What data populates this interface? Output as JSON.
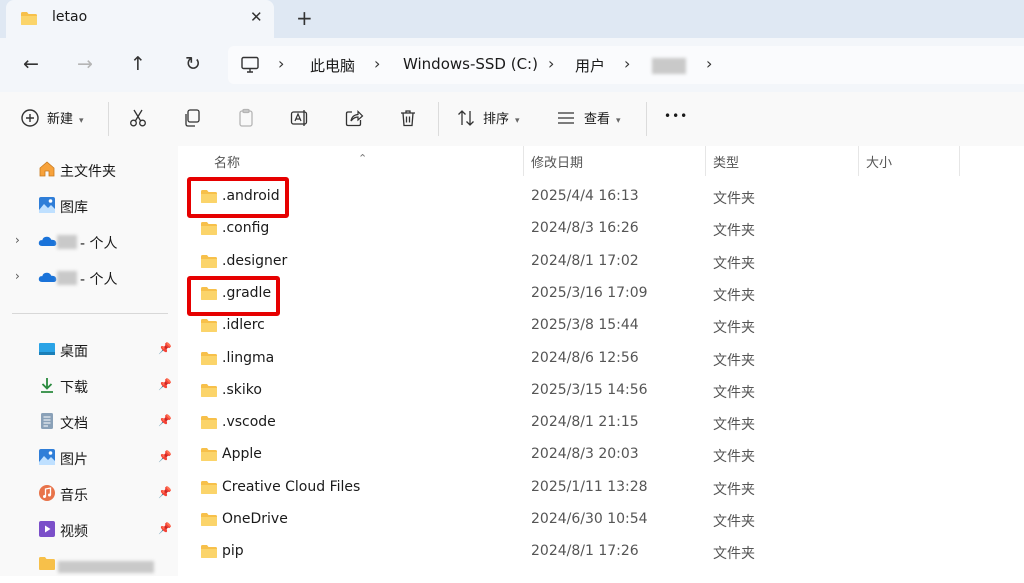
{
  "tab": {
    "title": "letao",
    "close_glyph": "✕",
    "new_glyph": "+"
  },
  "nav": {
    "back": "←",
    "forward": "→",
    "up": "↑",
    "refresh": "↻"
  },
  "breadcrumb": {
    "items": [
      "此电脑",
      "Windows-SSD (C:)",
      "用户"
    ],
    "separator": "›"
  },
  "toolbar": {
    "new_label": "新建",
    "sort_label": "排序",
    "view_label": "查看",
    "more_glyph": "•••"
  },
  "sidebar": {
    "home": "主文件夹",
    "gallery": "图库",
    "onedrive1_suffix": "- 个人",
    "onedrive2_suffix": "- 个人",
    "pinned": [
      "桌面",
      "下载",
      "文档",
      "图片",
      "音乐",
      "视频"
    ]
  },
  "columns": {
    "name": "名称",
    "date": "修改日期",
    "type": "类型",
    "size": "大小"
  },
  "files": [
    {
      "name": ".android",
      "date": "2025/4/4 16:13",
      "type": "文件夹"
    },
    {
      "name": ".config",
      "date": "2024/8/3 16:26",
      "type": "文件夹"
    },
    {
      "name": ".designer",
      "date": "2024/8/1 17:02",
      "type": "文件夹"
    },
    {
      "name": ".gradle",
      "date": "2025/3/16 17:09",
      "type": "文件夹"
    },
    {
      "name": ".idlerc",
      "date": "2025/3/8 15:44",
      "type": "文件夹"
    },
    {
      "name": ".lingma",
      "date": "2024/8/6 12:56",
      "type": "文件夹"
    },
    {
      "name": ".skiko",
      "date": "2025/3/15 14:56",
      "type": "文件夹"
    },
    {
      "name": ".vscode",
      "date": "2024/8/1 21:15",
      "type": "文件夹"
    },
    {
      "name": "Apple",
      "date": "2024/8/3 20:03",
      "type": "文件夹"
    },
    {
      "name": "Creative Cloud Files",
      "date": "2025/1/11 13:28",
      "type": "文件夹"
    },
    {
      "name": "OneDrive",
      "date": "2024/6/30 10:54",
      "type": "文件夹"
    },
    {
      "name": "pip",
      "date": "2024/8/1 17:26",
      "type": "文件夹"
    }
  ],
  "colors": {
    "highlight": "#e60000",
    "folder": "#f7c04a",
    "accent": "#0067c0"
  }
}
